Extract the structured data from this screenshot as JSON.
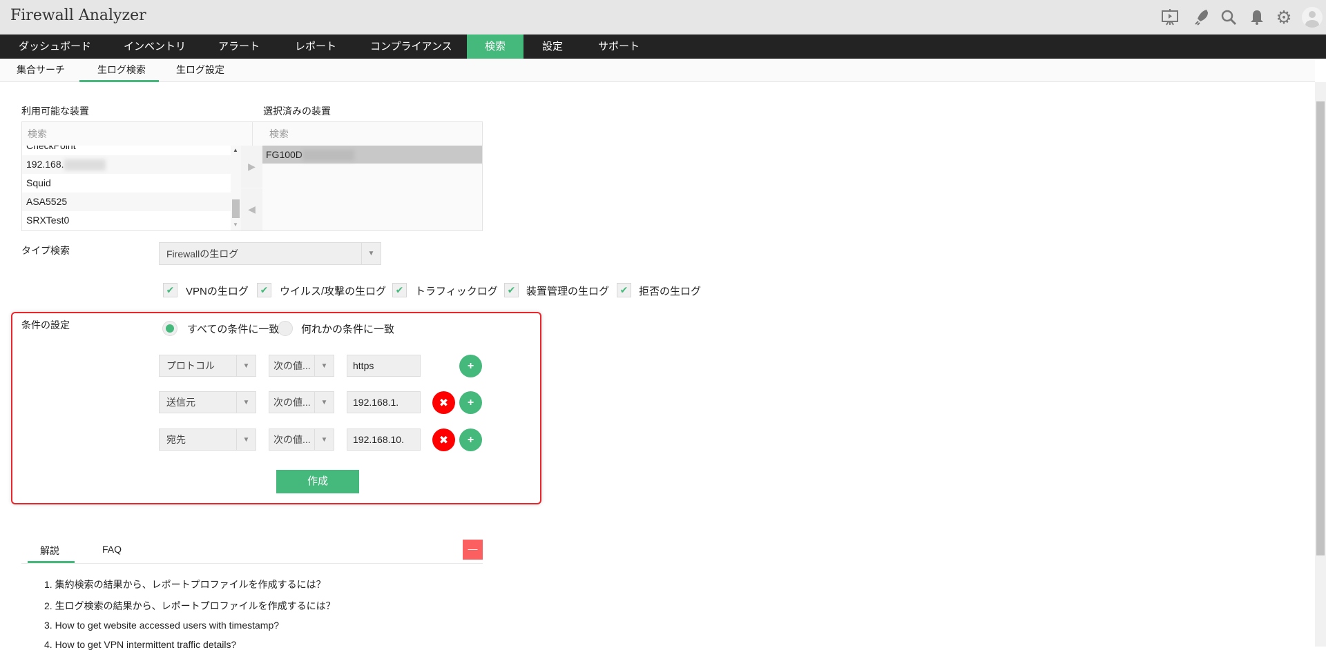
{
  "header": {
    "title": "Firewall Analyzer",
    "icons": [
      "presentation-icon",
      "rocket-icon",
      "search-icon",
      "bell-icon",
      "gear-icon",
      "user-avatar-icon"
    ]
  },
  "nav": {
    "items": [
      "ダッシュボード",
      "インベントリ",
      "アラート",
      "レポート",
      "コンプライアンス",
      "検索",
      "設定",
      "サポート"
    ],
    "active": "検索"
  },
  "subnav": {
    "items": [
      "集合サーチ",
      "生ログ検索",
      "生ログ設定"
    ],
    "active": "生ログ検索"
  },
  "devices": {
    "available_label": "利用可能な装置",
    "selected_label": "選択済みの装置",
    "search_placeholder": "検索",
    "available": [
      "CheckPoint",
      "192.168.",
      "Squid",
      "ASA5525",
      "SRXTest0"
    ],
    "selected": [
      "FG100D"
    ]
  },
  "type_search": {
    "label": "タイプ検索",
    "value": "Firewallの生ログ"
  },
  "log_types": [
    {
      "label": "VPNの生ログ",
      "checked": true
    },
    {
      "label": "ウイルス/攻撃の生ログ",
      "checked": true
    },
    {
      "label": "トラフィックログ",
      "checked": true
    },
    {
      "label": "装置管理の生ログ",
      "checked": true
    },
    {
      "label": "拒否の生ログ",
      "checked": true
    }
  ],
  "conditions": {
    "label": "条件の設定",
    "match_all": "すべての条件に一致",
    "match_any": "何れかの条件に一致",
    "selected": "all",
    "rows": [
      {
        "field": "プロトコル",
        "operator": "次の値...",
        "value": "https"
      },
      {
        "field": "送信元",
        "operator": "次の値...",
        "value": "192.168.1."
      },
      {
        "field": "宛先",
        "operator": "次の値...",
        "value": "192.168.10."
      }
    ],
    "create_label": "作成"
  },
  "help": {
    "tabs": [
      "解説",
      "FAQ"
    ],
    "active": "解説",
    "collapse": "—",
    "items": [
      "1. 集約検索の結果から、レポートプロファイルを作成するには？",
      "2. 生ログ検索の結果から、レポートプロファイルを作成するには？",
      "3. How to get website accessed users with timestamp?",
      "4. How to get VPN intermittent traffic details?"
    ]
  },
  "colors": {
    "accent": "#45b97c",
    "nav_bg": "#232323",
    "danger": "#ff0000",
    "frame": "#e8262b"
  }
}
